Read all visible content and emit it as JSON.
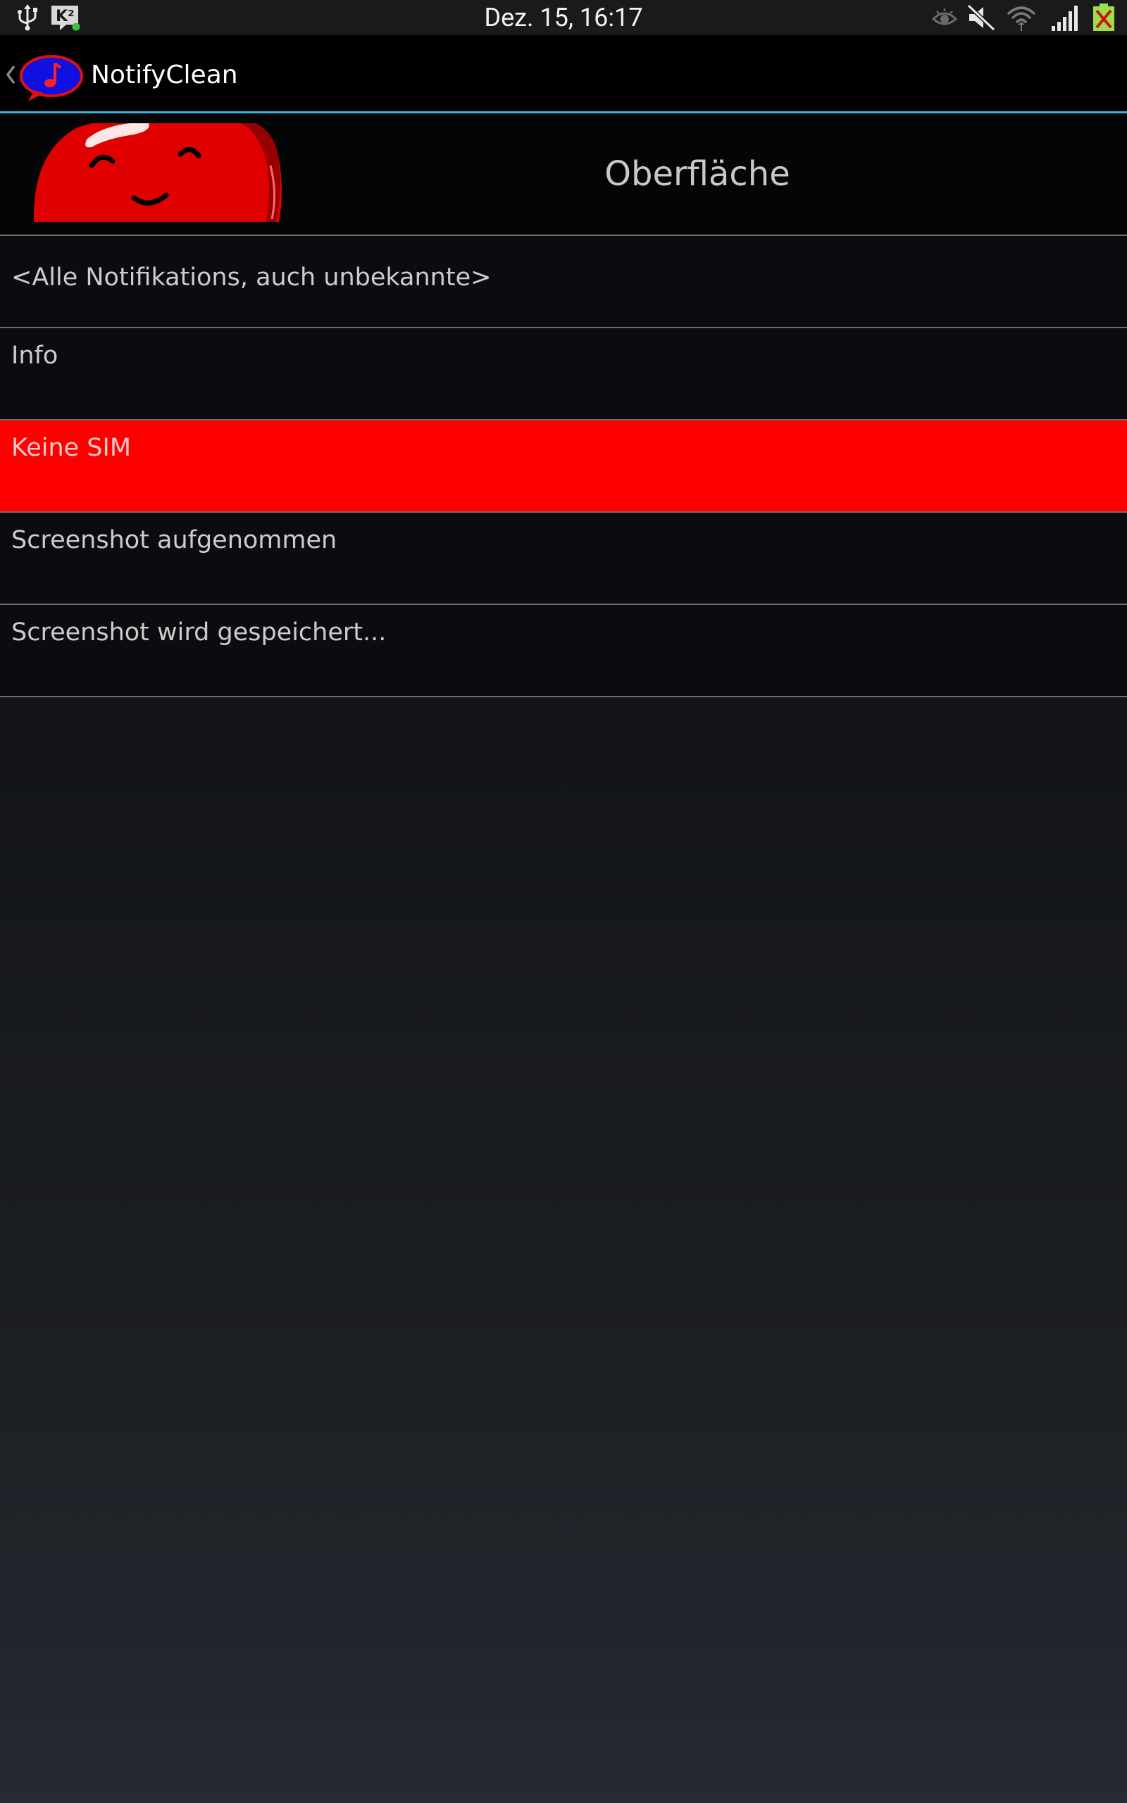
{
  "status_bar": {
    "time": "Dez. 15, 16:17",
    "k2_badge": "K²",
    "icons": [
      "usb-icon",
      "k2-icon",
      "eye-icon",
      "muted-icon",
      "wifi-icon",
      "signal-icon",
      "no-sim-icon"
    ]
  },
  "action_bar": {
    "title": "NotifyClean",
    "accent_color": "#33b5e5"
  },
  "header": {
    "title": "Oberfläche"
  },
  "list": {
    "selected_color": "#ff0000",
    "items": [
      {
        "label": "<Alle Notifikations, auch unbekannte>"
      },
      {
        "label": "Info"
      },
      {
        "label": "Keine SIM"
      },
      {
        "label": "Screenshot aufgenommen"
      },
      {
        "label": "Screenshot wird gespeichert..."
      }
    ]
  }
}
